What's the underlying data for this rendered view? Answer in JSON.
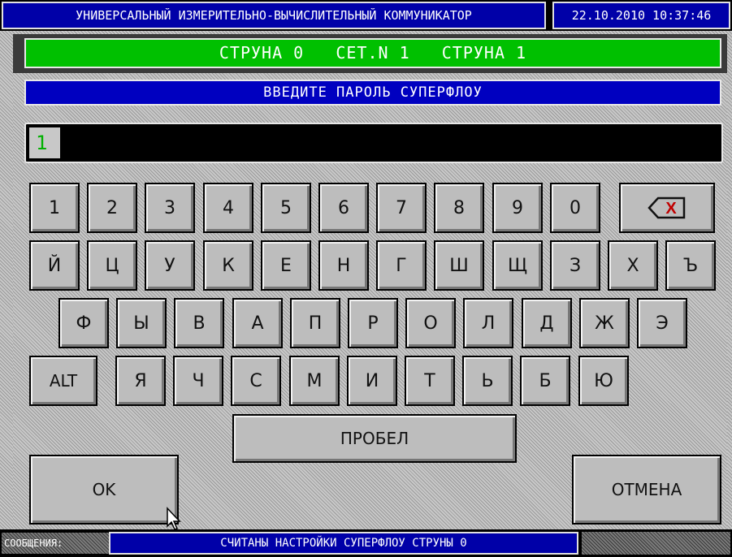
{
  "header": {
    "app_title": "УНИВЕРСАЛЬНЫЙ ИЗМЕРИТЕЛЬНО-ВЫЧИСЛИТЕЛЬНЫЙ КОММУНИКАТОР",
    "datetime": "22.10.2010 10:37:46"
  },
  "status_bar": {
    "text": "СТРУНА 0   СЕТ.N 1   СТРУНА 1"
  },
  "prompt": "ВВЕДИТЕ ПАРОЛЬ СУПЕРФЛОУ",
  "password_input": {
    "value": "1"
  },
  "keyboard": {
    "row1": [
      "1",
      "2",
      "3",
      "4",
      "5",
      "6",
      "7",
      "8",
      "9",
      "0"
    ],
    "backspace_label": "X",
    "row2": [
      "Й",
      "Ц",
      "У",
      "К",
      "Е",
      "Н",
      "Г",
      "Ш",
      "Щ",
      "З",
      "Х",
      "Ъ"
    ],
    "row3": [
      "Ф",
      "Ы",
      "В",
      "А",
      "П",
      "Р",
      "О",
      "Л",
      "Д",
      "Ж",
      "Э"
    ],
    "alt_label": "ALT",
    "row4": [
      "Я",
      "Ч",
      "С",
      "М",
      "И",
      "Т",
      "Ь",
      "Б",
      "Ю"
    ],
    "space_label": "ПРОБЕЛ"
  },
  "buttons": {
    "ok": "OK",
    "cancel": "ОТМЕНА"
  },
  "messages": {
    "label": "СООБЩЕНИЯ:",
    "text": "СЧИТАНЫ НАСТРОЙКИ СУПЕРФЛОУ СТРУНЫ 0"
  },
  "colors": {
    "title_bg": "#0000a8",
    "status_green": "#00c000",
    "prompt_blue": "#0000c0",
    "input_cursor_text": "#00b000",
    "key_face": "#bdbdbd"
  }
}
